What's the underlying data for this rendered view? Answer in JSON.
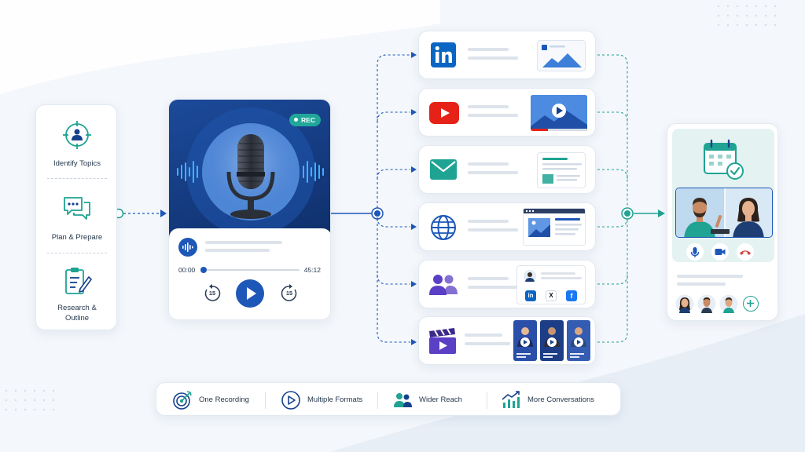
{
  "steps": [
    {
      "label": "Identify Topics",
      "icon": "target-person-icon"
    },
    {
      "label": "Plan & Prepare",
      "icon": "chat-bubbles-icon"
    },
    {
      "label": "Research & Outline",
      "icon": "clipboard-pen-icon"
    }
  ],
  "podcast": {
    "rec_label": "REC",
    "time_current": "00:00",
    "time_total": "45:12",
    "skip_back": "15",
    "skip_forward": "15",
    "progress": 0.02
  },
  "channels": [
    {
      "name": "linkedin",
      "icon": "linkedin-icon"
    },
    {
      "name": "youtube",
      "icon": "youtube-icon"
    },
    {
      "name": "email",
      "icon": "email-icon"
    },
    {
      "name": "website",
      "icon": "globe-icon"
    },
    {
      "name": "social",
      "icon": "people-icon"
    },
    {
      "name": "video",
      "icon": "clapperboard-icon"
    }
  ],
  "bottom": [
    {
      "label": "One Recording",
      "icon": "target-arrow-icon"
    },
    {
      "label": "Multiple Formats",
      "icon": "play-circle-icon"
    },
    {
      "label": "Wider Reach",
      "icon": "group-icon"
    },
    {
      "label": "More Conversations",
      "icon": "growth-chart-icon"
    }
  ],
  "social_badges": {
    "li": "in",
    "x": "X",
    "fb": "f"
  },
  "colors": {
    "teal": "#1fa393",
    "navy": "#15418a",
    "blue": "#1d57b8",
    "red": "#e62117",
    "linkedin": "#0a66c2",
    "purple": "#5b3fc4"
  }
}
